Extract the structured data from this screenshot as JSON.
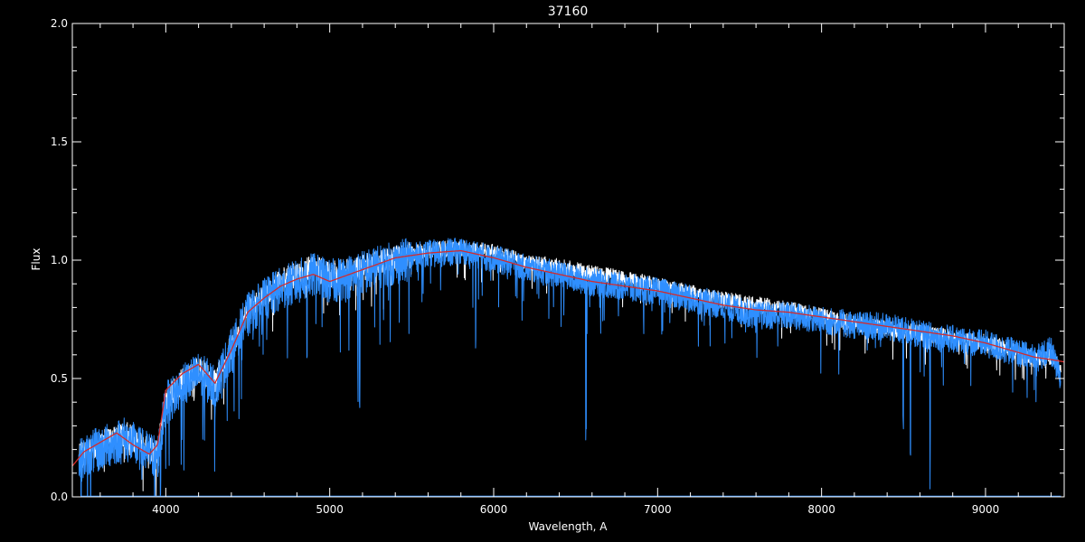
{
  "chart_data": {
    "type": "line",
    "title": "37160",
    "xlabel": "Wavelength, A",
    "ylabel": "Flux",
    "xlim": [
      3430,
      9480
    ],
    "ylim": [
      0,
      2
    ],
    "x_ticks": [
      4000,
      5000,
      6000,
      7000,
      8000,
      9000
    ],
    "x_tick_labels": [
      "4000",
      "5000",
      "6000",
      "7000",
      "8000",
      "9000"
    ],
    "x_minor_step": 200,
    "y_ticks": [
      0,
      0.5,
      1,
      1.5,
      2
    ],
    "y_tick_labels": [
      "0.0",
      "0.5",
      "1.0",
      "1.5",
      "2.0"
    ],
    "y_minor_step": 0.1,
    "grid": false,
    "background": "#000000",
    "foreground": "#ffffff",
    "series": [
      {
        "key": "white_spectrum",
        "color": "#ffffff",
        "noise": 0.035,
        "x": [
          3470,
          3550,
          3650,
          3750,
          3850,
          3950,
          4000,
          4100,
          4200,
          4300,
          4400,
          4500,
          4600,
          4700,
          4800,
          4900,
          5000,
          5200,
          5400,
          5600,
          5800,
          6000,
          6200,
          6400,
          6600,
          6800,
          7000,
          7200,
          7400,
          7600,
          7800,
          8000,
          8200,
          8400,
          8600,
          8800,
          9000,
          9200,
          9300,
          9400,
          9460
        ],
        "y": [
          0.18,
          0.22,
          0.25,
          0.28,
          0.23,
          0.2,
          0.42,
          0.5,
          0.55,
          0.5,
          0.65,
          0.8,
          0.86,
          0.92,
          0.95,
          0.98,
          0.95,
          0.98,
          1.02,
          1.05,
          1.06,
          1.04,
          1.0,
          0.98,
          0.95,
          0.93,
          0.9,
          0.87,
          0.84,
          0.82,
          0.8,
          0.77,
          0.74,
          0.72,
          0.7,
          0.68,
          0.66,
          0.62,
          0.59,
          0.6,
          0.55
        ]
      },
      {
        "key": "blue_spectrum",
        "color": "#2f8fff",
        "noise": 0.06,
        "x": [
          3470,
          3550,
          3650,
          3750,
          3850,
          3950,
          4000,
          4100,
          4200,
          4300,
          4400,
          4500,
          4600,
          4700,
          4800,
          4900,
          5000,
          5200,
          5400,
          5600,
          5800,
          6000,
          6200,
          6400,
          6600,
          6800,
          7000,
          7200,
          7400,
          7600,
          7800,
          8000,
          8200,
          8400,
          8600,
          8800,
          9000,
          9200,
          9300,
          9400,
          9460
        ],
        "y": [
          0.17,
          0.21,
          0.24,
          0.27,
          0.22,
          0.19,
          0.41,
          0.49,
          0.54,
          0.49,
          0.64,
          0.79,
          0.85,
          0.9,
          0.93,
          0.96,
          0.93,
          0.97,
          1.01,
          1.04,
          1.05,
          1.02,
          0.98,
          0.95,
          0.92,
          0.9,
          0.88,
          0.85,
          0.82,
          0.78,
          0.78,
          0.76,
          0.74,
          0.73,
          0.7,
          0.68,
          0.66,
          0.62,
          0.6,
          0.63,
          0.5
        ]
      },
      {
        "key": "red_model",
        "color": "#d42a2a",
        "noise": 0,
        "x": [
          3430,
          3500,
          3600,
          3700,
          3800,
          3900,
          3950,
          4000,
          4100,
          4200,
          4300,
          4400,
          4500,
          4600,
          4700,
          4800,
          4900,
          5000,
          5200,
          5400,
          5600,
          5800,
          6000,
          6200,
          6400,
          6600,
          6800,
          7000,
          7200,
          7400,
          7600,
          7800,
          8000,
          8200,
          8400,
          8600,
          8800,
          9000,
          9200,
          9300,
          9400,
          9480
        ],
        "y": [
          0.13,
          0.19,
          0.23,
          0.27,
          0.22,
          0.18,
          0.22,
          0.45,
          0.52,
          0.56,
          0.48,
          0.62,
          0.78,
          0.84,
          0.89,
          0.92,
          0.94,
          0.91,
          0.96,
          1.01,
          1.03,
          1.04,
          1.01,
          0.97,
          0.94,
          0.91,
          0.89,
          0.87,
          0.84,
          0.81,
          0.79,
          0.78,
          0.76,
          0.74,
          0.72,
          0.7,
          0.68,
          0.65,
          0.61,
          0.59,
          0.58,
          0.57
        ]
      }
    ],
    "absorption_lines": [
      {
        "x": 3933,
        "depth": 0.25
      },
      {
        "x": 3968,
        "depth": 0.18
      },
      {
        "x": 4227,
        "depth": 0.22
      },
      {
        "x": 4300,
        "depth": 0.2
      },
      {
        "x": 4861,
        "depth": 0.35
      },
      {
        "x": 5172,
        "depth": 0.45
      },
      {
        "x": 5183,
        "depth": 0.5
      },
      {
        "x": 5890,
        "depth": 0.38
      },
      {
        "x": 6563,
        "depth": 0.6
      },
      {
        "x": 8498,
        "depth": 0.38
      },
      {
        "x": 8542,
        "depth": 0.5
      },
      {
        "x": 8662,
        "depth": 0.45
      }
    ]
  }
}
